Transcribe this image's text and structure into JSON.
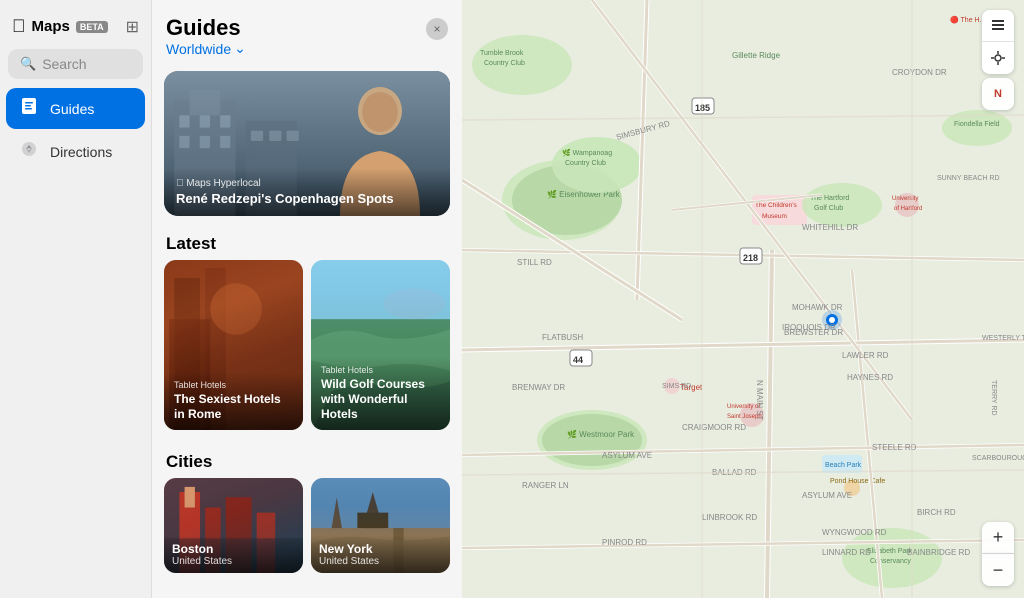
{
  "app": {
    "name": "Maps",
    "beta": "BETA"
  },
  "sidebar": {
    "search_placeholder": "Search",
    "nav_items": [
      {
        "id": "guides",
        "label": "Guides",
        "icon": "📋",
        "active": true
      },
      {
        "id": "directions",
        "label": "Directions",
        "icon": "🚗",
        "active": false
      }
    ]
  },
  "panel": {
    "title": "Guides",
    "subtitle": "Worldwide",
    "close_label": "×",
    "hero": {
      "source": "Maps",
      "type": "Hyperlocal",
      "title": "René Redzepi's Copenhagen Spots"
    },
    "latest_label": "Latest",
    "latest_cards": [
      {
        "source": "Tablet Hotels",
        "title": "The Sexiest Hotels in Rome"
      },
      {
        "source": "Tablet Hotels",
        "title": "Wild Golf Courses with Wonderful Hotels"
      }
    ],
    "cities_label": "Cities",
    "cities": [
      {
        "name": "Boston",
        "country": "United States"
      },
      {
        "name": "New York",
        "country": "United States"
      }
    ]
  },
  "map": {
    "north_label": "N",
    "zoom_in": "+",
    "zoom_out": "−"
  }
}
